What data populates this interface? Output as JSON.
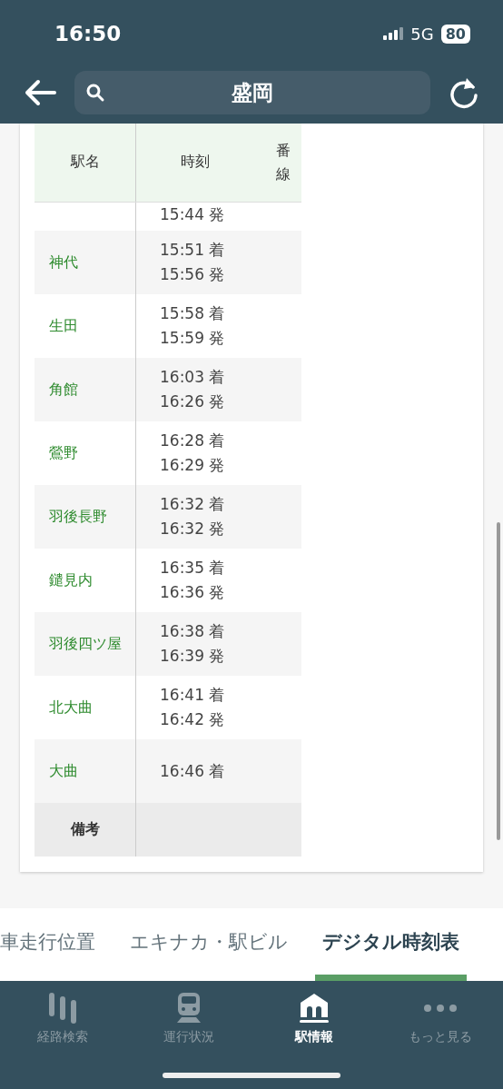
{
  "status_bar": {
    "time": "16:50",
    "network": "5G",
    "battery": "80"
  },
  "header": {
    "search_value": "盛岡"
  },
  "table": {
    "columns": [
      "駅名",
      "時刻",
      "番線"
    ],
    "partial_row": {
      "times": [
        "15:44 発"
      ]
    },
    "rows": [
      {
        "station": "神代",
        "times": [
          "15:51 着",
          "15:56 発"
        ]
      },
      {
        "station": "生田",
        "times": [
          "15:58 着",
          "15:59 発"
        ]
      },
      {
        "station": "角館",
        "times": [
          "16:03 着",
          "16:26 発"
        ]
      },
      {
        "station": "鶯野",
        "times": [
          "16:28 着",
          "16:29 発"
        ]
      },
      {
        "station": "羽後長野",
        "times": [
          "16:32 着",
          "16:32 発"
        ]
      },
      {
        "station": "鑓見内",
        "times": [
          "16:35 着",
          "16:36 発"
        ]
      },
      {
        "station": "羽後四ツ屋",
        "times": [
          "16:38 着",
          "16:39 発"
        ]
      },
      {
        "station": "北大曲",
        "times": [
          "16:41 着",
          "16:42 発"
        ]
      },
      {
        "station": "大曲",
        "times": [
          "16:46 着"
        ]
      }
    ],
    "remarks_label": "備考"
  },
  "tabs": [
    {
      "label": "車走行位置",
      "selected": false
    },
    {
      "label": "エキナカ・駅ビル",
      "selected": false
    },
    {
      "label": "デジタル時刻表",
      "selected": true
    }
  ],
  "bottom_nav": [
    {
      "label": "経路検索",
      "kind": "route",
      "selected": false
    },
    {
      "label": "運行状況",
      "kind": "train",
      "selected": false
    },
    {
      "label": "駅情報",
      "kind": "station",
      "selected": true
    },
    {
      "label": "もっと見る",
      "kind": "more",
      "selected": false
    }
  ]
}
